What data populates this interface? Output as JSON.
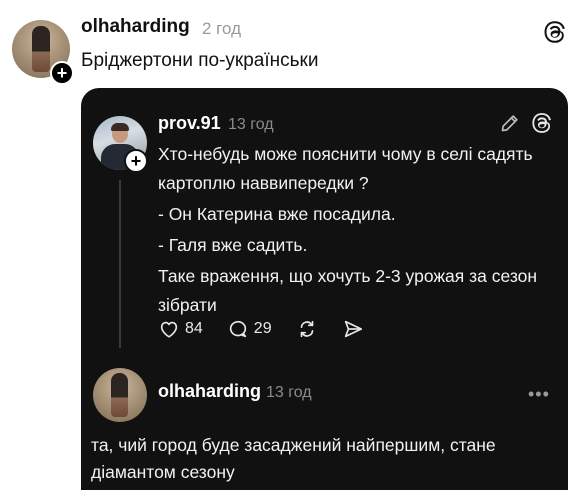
{
  "post": {
    "username": "olhaharding",
    "time": "2 год",
    "text": "Бріджертони по-українськи"
  },
  "quoted": {
    "username": "prov.91",
    "time": "13 год",
    "lines": [
      "Хто-небудь може пояснити чому в селі садять картоплю наввипередки ?",
      "- Он Катерина вже посадила.",
      "- Галя вже садить.",
      "Таке враження, що хочуть 2-3 урожая за сезон зібрати"
    ],
    "likes": "84",
    "comments": "29"
  },
  "reply": {
    "username": "olhaharding",
    "time": "13 год",
    "text": "та, чий город буде засаджений найпершим, стане діамантом сезону"
  },
  "icons": {
    "threads": "threads-logo-icon",
    "plus": "+",
    "more": "•••"
  }
}
